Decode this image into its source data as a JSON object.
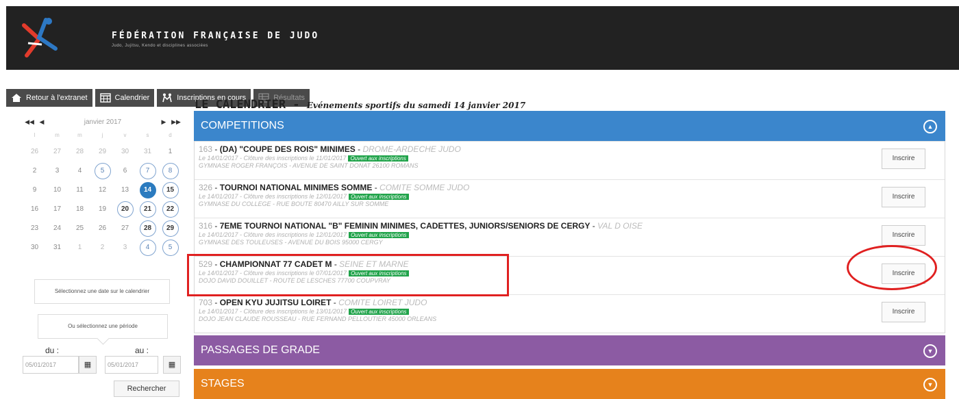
{
  "header": {
    "title": "FÉDÉRATION FRANÇAISE DE JUDO",
    "subtitle": "Judo, Jujitsu, Kendo et disciplines associées",
    "logo_text": "FF judo"
  },
  "nav": [
    {
      "label": "Retour à l'extranet",
      "icon": "home-icon"
    },
    {
      "label": "Calendrier",
      "icon": "calendar-icon"
    },
    {
      "label": "Inscriptions en cours",
      "icon": "judoka-icon"
    },
    {
      "label": "Résultats",
      "icon": "results-icon"
    }
  ],
  "calendar": {
    "month": "janvier 2017",
    "prev_year": "◀◀",
    "prev_month": "◀",
    "next_month": "▶",
    "next_year": "▶▶",
    "weekdays": [
      "l",
      "m",
      "m",
      "j",
      "v",
      "s",
      "d"
    ],
    "weeks": [
      [
        "26",
        "27",
        "28",
        "29",
        "30",
        "31",
        "1"
      ],
      [
        "2",
        "3",
        "4",
        "5",
        "6",
        "7",
        "8"
      ],
      [
        "9",
        "10",
        "11",
        "12",
        "13",
        "14",
        "15"
      ],
      [
        "16",
        "17",
        "18",
        "19",
        "20",
        "21",
        "22"
      ],
      [
        "23",
        "24",
        "25",
        "26",
        "27",
        "28",
        "29"
      ],
      [
        "30",
        "31",
        "1",
        "2",
        "3",
        "4",
        "5"
      ]
    ],
    "select_date_text": "Sélectionnez une date sur le calendrier",
    "select_period_text": "Ou sélectionnez une période",
    "from_label": "du :",
    "to_label": "au :",
    "from_value": "05/01/2017",
    "to_value": "05/01/2017",
    "search_label": "Rechercher"
  },
  "main": {
    "title": "LE CALENDRIER",
    "title_sep": " - ",
    "subtitle": "Evénements sportifs du samedi 14 janvier 2017",
    "sections": {
      "competitions": "COMPETITIONS",
      "grades": "PASSAGES DE GRADE",
      "stages": "STAGES"
    },
    "competitions": [
      {
        "num": "163",
        "name": "(DA) \"COUPE DES ROIS\" MINIMES",
        "club": "DROME-ARDECHE JUDO",
        "date_line": "Le 14/01/2017 - Clôture des inscriptions le 11/01/2017",
        "status": "Ouvert aux inscriptions",
        "venue": "GYMNASE ROGER FRANÇOIS - AVENUE DE SAINT DONAT 26100 ROMANS",
        "button": "Inscrire"
      },
      {
        "num": "326",
        "name": "TOURNOI NATIONAL MINIMES SOMME",
        "club": "COMITE SOMME JUDO",
        "date_line": "Le 14/01/2017 - Clôture des inscriptions le 12/01/2017",
        "status": "Ouvert aux inscriptions",
        "venue": "GYMNASE DU COLLEGE - RUE BOUTE 80470 AILLY SUR SOMME",
        "button": "Inscrire"
      },
      {
        "num": "316",
        "name": "7EME TOURNOI NATIONAL \"B\" FEMININ MINIMES, CADETTES, JUNIORS/SENIORS DE CERGY",
        "club": "VAL D OISE",
        "date_line": "Le 14/01/2017 - Clôture des inscriptions le 12/01/2017",
        "status": "Ouvert aux inscriptions",
        "venue": "GYMNASE DES TOULEUSES - AVENUE DU BOIS 95000 CERGY",
        "button": "Inscrire"
      },
      {
        "num": "529",
        "name": "CHAMPIONNAT 77 CADET M",
        "club": "SEINE ET MARNE",
        "date_line": "Le 14/01/2017 - Clôture des inscriptions le 07/01/2017",
        "status": "Ouvert aux inscriptions",
        "venue": "DOJO DAVID DOUILLET - ROUTE DE LESCHES 77700 COUPVRAY",
        "button": "Inscrire"
      },
      {
        "num": "703",
        "name": "OPEN KYU JUJITSU LOIRET",
        "club": "COMITE LOIRET JUDO",
        "date_line": "Le 14/01/2017 - Clôture des inscriptions le 13/01/2017",
        "status": "Ouvert aux inscriptions",
        "venue": "DOJO JEAN CLAUDE ROUSSEAU - RUE FERNAND PELLOUTIER 45000 ORLEANS",
        "button": "Inscrire"
      }
    ]
  },
  "colors": {
    "competitions": "#3b86cc",
    "grades": "#8c5ba3",
    "stages": "#e6821c",
    "highlight": "#e02020",
    "status_badge": "#20a34a"
  }
}
